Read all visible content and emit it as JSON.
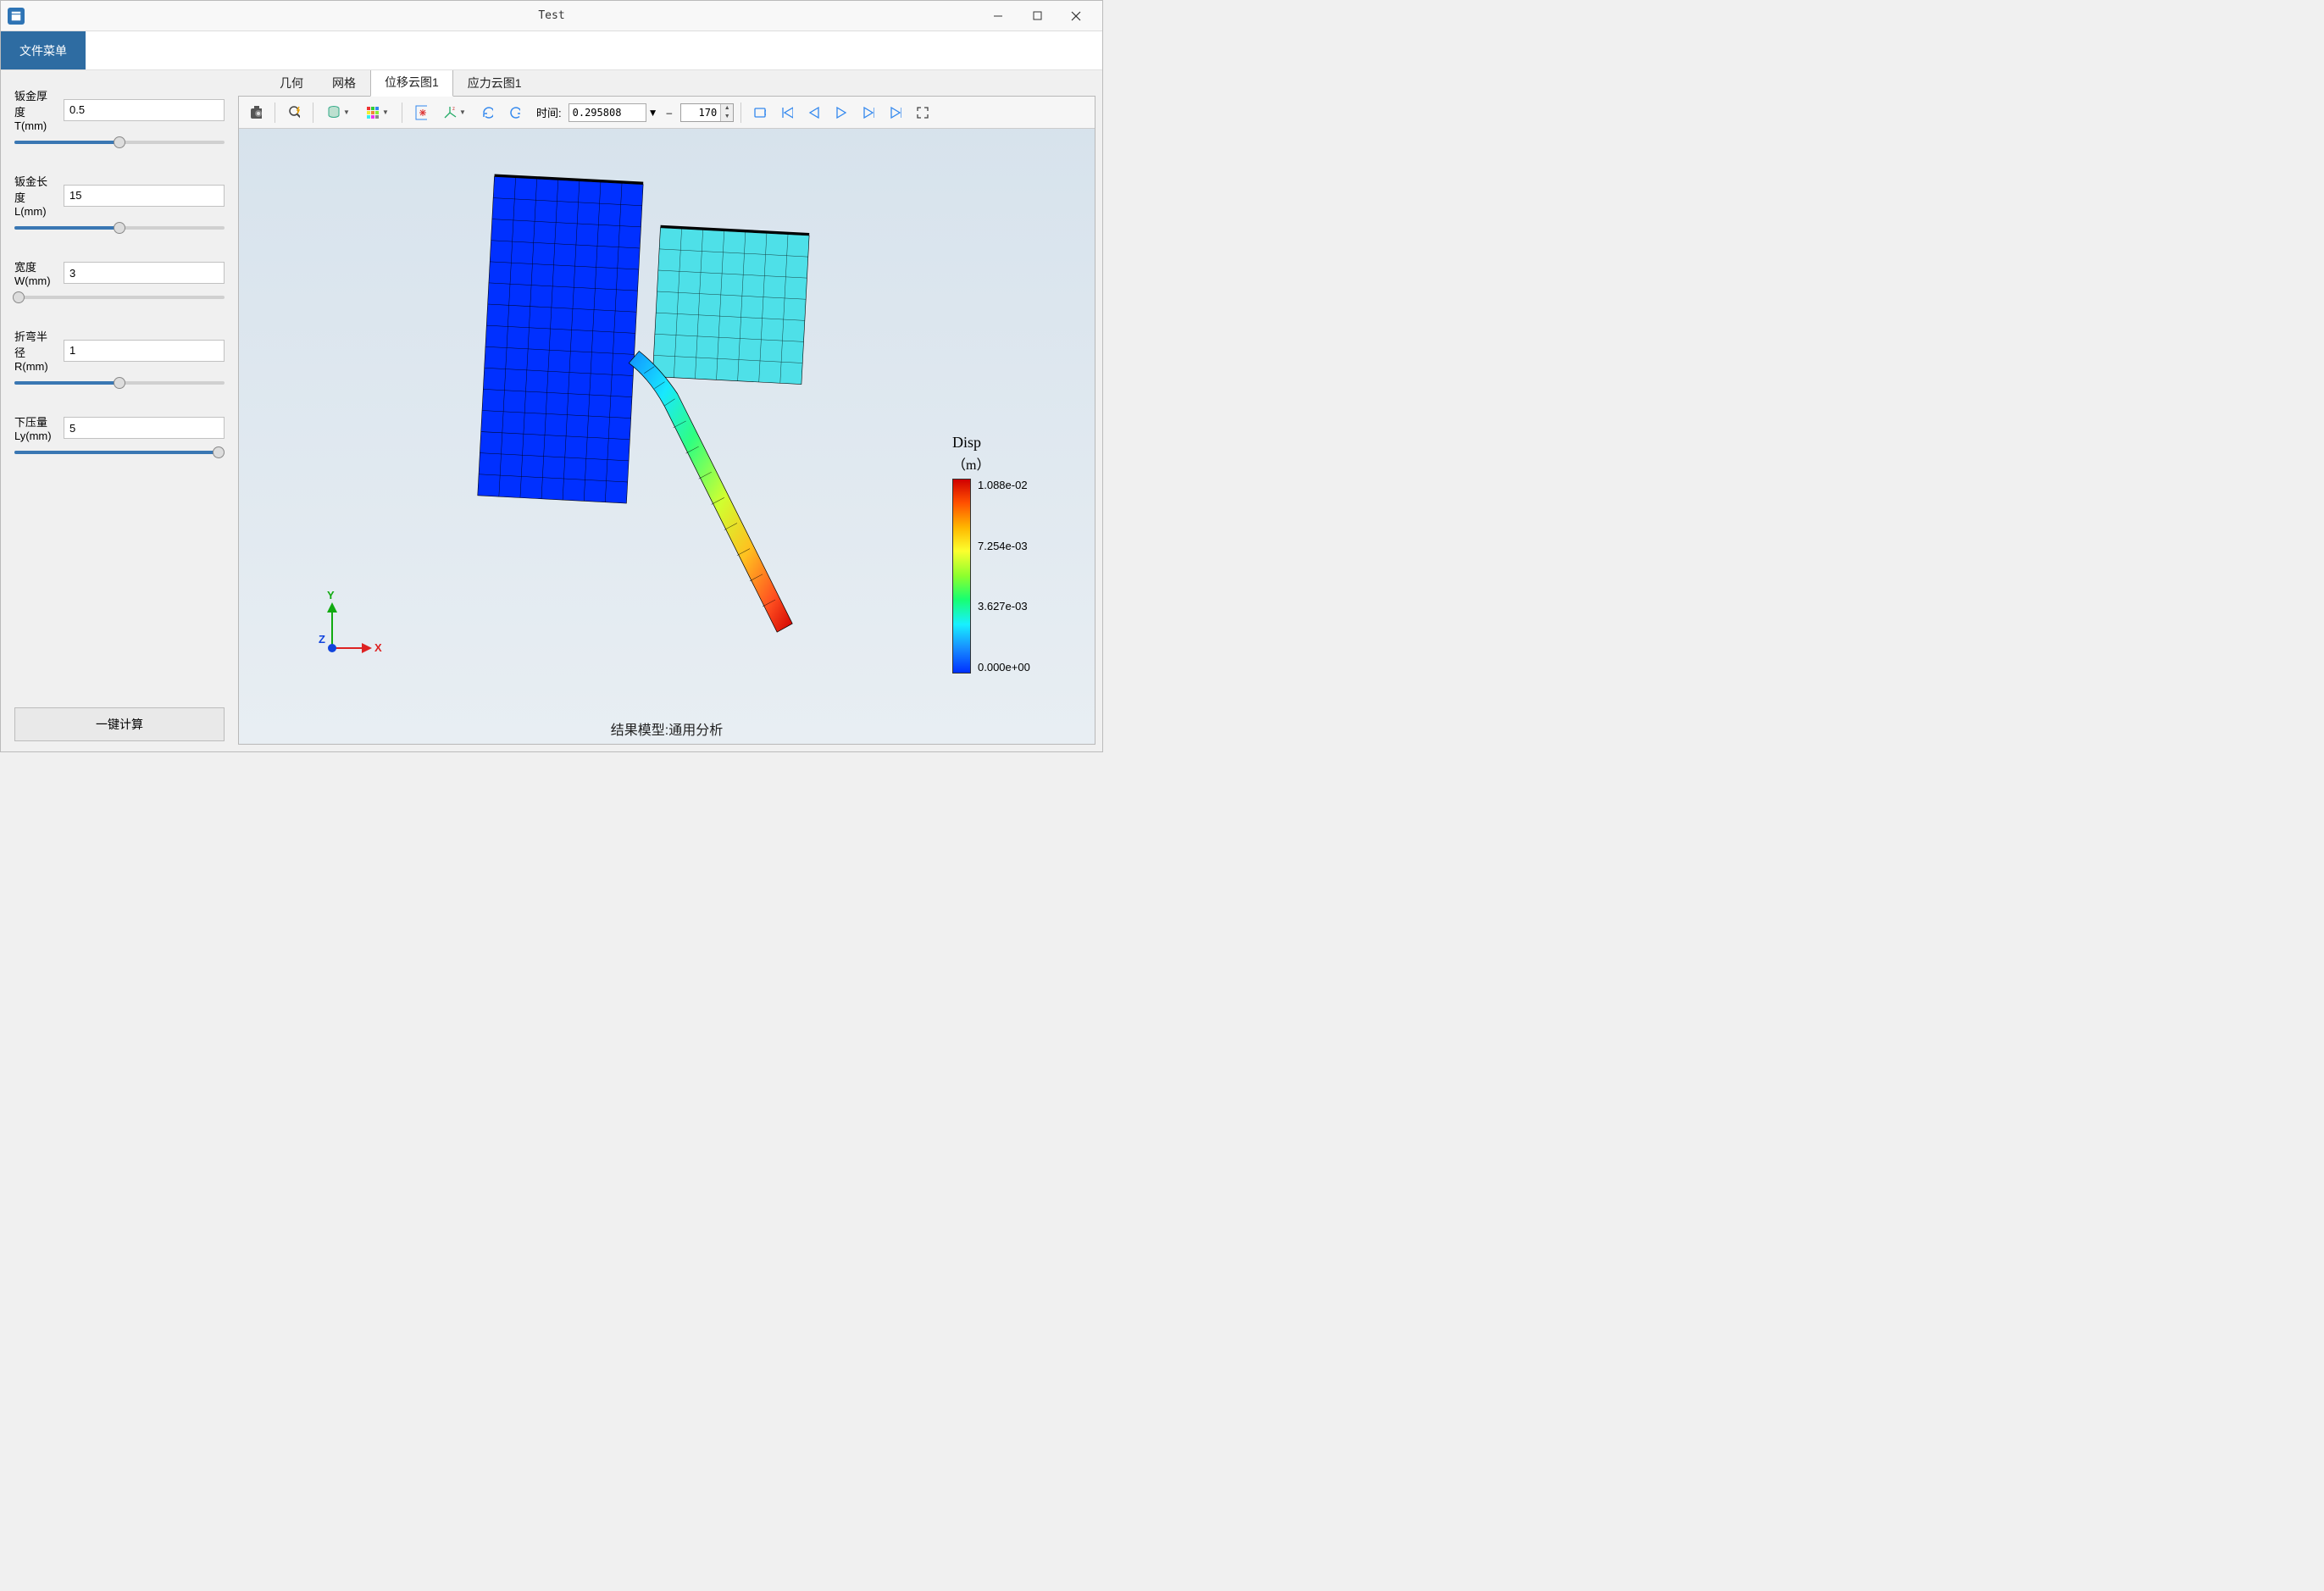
{
  "window": {
    "title": "Test"
  },
  "menu": {
    "file": "文件菜单"
  },
  "sidebar": {
    "params": [
      {
        "label": "钣金厚度T(mm)",
        "value": "0.5",
        "thumb_pct": 50
      },
      {
        "label": "钣金长度L(mm)",
        "value": "15",
        "thumb_pct": 50
      },
      {
        "label": "宽度W(mm)",
        "value": "3",
        "thumb_pct": 2
      },
      {
        "label": "折弯半径R(mm)",
        "value": "1",
        "thumb_pct": 50
      },
      {
        "label": "下压量Ly(mm)",
        "value": "5",
        "thumb_pct": 97
      }
    ],
    "calc_button": "一键计算"
  },
  "tabs": {
    "items": [
      "几何",
      "网格",
      "位移云图1",
      "应力云图1"
    ],
    "active_index": 2
  },
  "toolbar": {
    "time_label": "时间:",
    "time_value": "0.295808",
    "frame_value": "170"
  },
  "viewport": {
    "axis": {
      "x": "X",
      "y": "Y",
      "z": "Z"
    },
    "footer": "结果模型:通用分析"
  },
  "legend": {
    "title": "Disp",
    "subtitle": "（m）",
    "ticks": [
      "1.088e-02",
      "7.254e-03",
      "3.627e-03",
      "0.000e+00"
    ]
  },
  "chart_data": {
    "type": "heatmap",
    "title": "Disp",
    "unit": "m",
    "colorbar_range": [
      0.0,
      0.01088
    ],
    "colorbar_ticks": [
      0.0,
      0.003627,
      0.007254,
      0.01088
    ],
    "note": "Displacement contour of sheet-metal bending simulation; punch block (left) ≈0 disp (blue), die block (right) low disp (cyan), bent sheet tail reaches max ≈1.088e-02 m (red)."
  }
}
